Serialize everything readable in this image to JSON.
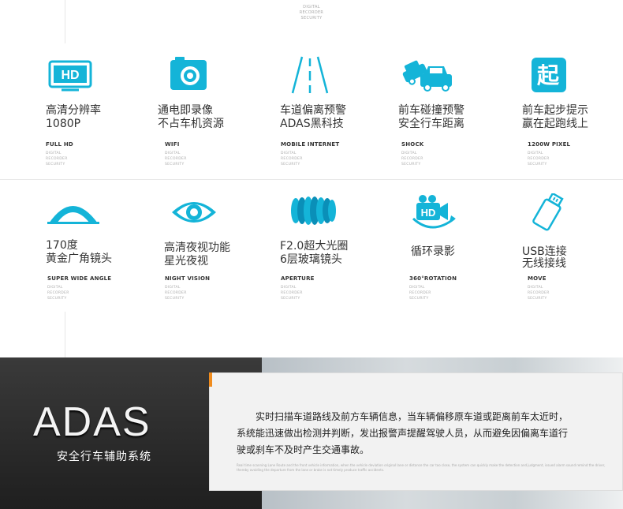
{
  "top_note": [
    "DIGITAL",
    "RECORDER",
    "SECURITY"
  ],
  "mini_caption": [
    "DIGITAL",
    "RECORDER",
    "SECURITY"
  ],
  "colors": {
    "accent": "#14b4d8",
    "accent_dark": "#0a8fb8",
    "adas_bar": "#f08c1e"
  },
  "features_row1": [
    {
      "icon": "hd-monitor-icon",
      "line1": "高清分辨率",
      "line2": "1080P",
      "sub": "FULL HD"
    },
    {
      "icon": "camera-icon",
      "line1": "通电即录像",
      "line2": "不占车机资源",
      "sub": "WIFI"
    },
    {
      "icon": "lane-road-icon",
      "line1": "车道偏离预警",
      "line2": "ADAS黑科技",
      "sub": "MOBILE INTERNET"
    },
    {
      "icon": "car-collision-icon",
      "line1": "前车碰撞预警",
      "line2": "安全行车距离",
      "sub": "SHOCK"
    },
    {
      "icon": "start-character-icon",
      "glyph": "起",
      "line1": "前车起步提示",
      "line2": "赢在起跑线上",
      "sub": "1200W PIXEL"
    }
  ],
  "features_row2": [
    {
      "icon": "wide-angle-lens-icon",
      "line1": "170度",
      "line2": "黄金广角镜头",
      "sub": "SUPER WIDE ANGLE"
    },
    {
      "icon": "eye-icon",
      "line1": "高清夜视功能",
      "line2": "星光夜视",
      "sub": "NIGHT VISION"
    },
    {
      "icon": "glass-lens-stack-icon",
      "line1": "F2.0超大光圈",
      "line2": "6层玻璃镜头",
      "sub": "APERTURE"
    },
    {
      "icon": "hd-recording-loop-icon",
      "line1": "循环录影",
      "line2": "",
      "sub": "360°ROTATION"
    },
    {
      "icon": "usb-stick-icon",
      "line1": "USB连接",
      "line2": "无线接线",
      "sub": "MOVE"
    }
  ],
  "adas": {
    "logo": "ADAS",
    "subtitle": "安全行车辅助系统",
    "desc_lines": [
      "实时扫描车道路线及前方车辆信息，当车辆偏移原车道或距离前车太近时，",
      "系统能迅速做出检测并判断，发出报警声提醒驾驶人员，从而避免因偏离车道行",
      "驶或刹车不及时产生交通事故。"
    ],
    "fine_print": "Real time scanning Lane Route and the front vehicle information, when the vehicle deviation original lane or distance the car too close, the system can quickly make the detection and judgment, issued alarm sound remind the driver, thereby avoiding the departure from the lane or brake is not timely produce traffic accidents."
  }
}
